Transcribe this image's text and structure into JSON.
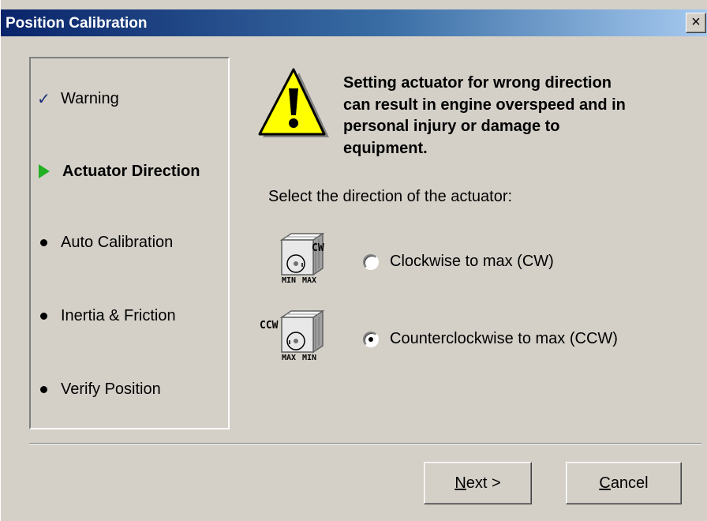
{
  "window": {
    "title": "Position Calibration",
    "close_glyph": "×"
  },
  "steps": [
    {
      "label": "Warning",
      "state": "done",
      "icon": "check-icon"
    },
    {
      "label": "Actuator Direction",
      "state": "current",
      "icon": "green-arrow-icon"
    },
    {
      "label": "Auto Calibration",
      "state": "pending",
      "icon": "bullet-icon"
    },
    {
      "label": "Inertia & Friction",
      "state": "pending",
      "icon": "bullet-icon"
    },
    {
      "label": "Verify Position",
      "state": "pending",
      "icon": "bullet-icon"
    }
  ],
  "warning": {
    "icon": "warning-icon",
    "lines": [
      "Setting actuator for wrong direction",
      "can result in engine overspeed and in",
      "personal injury or damage to",
      "equipment."
    ]
  },
  "prompt": "Select the direction of the actuator:",
  "options": [
    {
      "label": "Clockwise to max (CW)",
      "checked": false,
      "icon": "cw-actuator-icon",
      "icon_text": [
        "CW",
        "MIN",
        "MAX"
      ]
    },
    {
      "label": "Counterclockwise to max (CCW)",
      "checked": true,
      "icon": "ccw-actuator-icon",
      "icon_text": [
        "CCW",
        "MAX",
        "MIN"
      ]
    }
  ],
  "buttons": {
    "next_mnemonic": "N",
    "next_rest": "ext >",
    "cancel_mnemonic": "C",
    "cancel_rest": "ancel"
  },
  "colors": {
    "face": "#d4d0c8",
    "title_start": "#0a246a",
    "title_end": "#a6caf0",
    "check": "#1a2e7a",
    "arrow": "#22b022",
    "warning_yellow": "#ffff00"
  }
}
